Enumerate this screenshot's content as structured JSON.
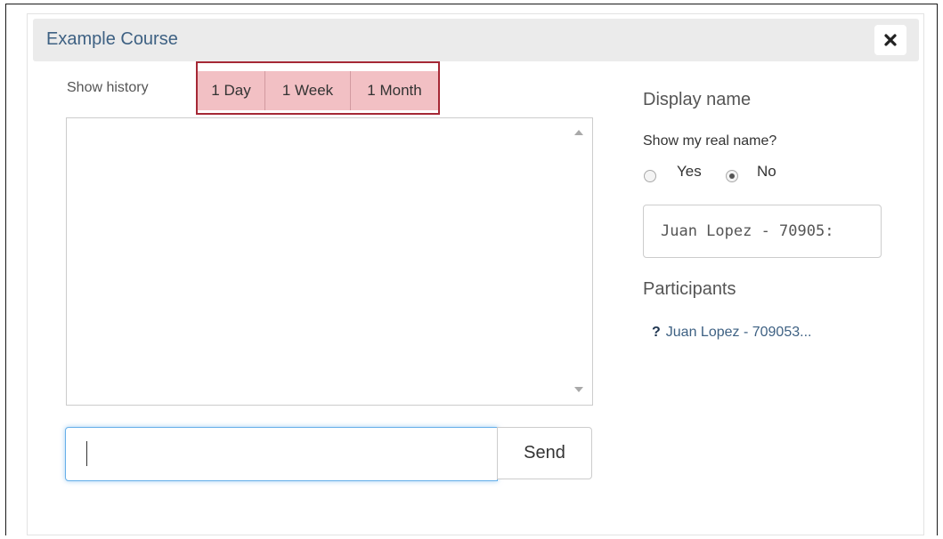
{
  "dialog": {
    "title": "Example Course",
    "close_icon": "close-icon"
  },
  "history": {
    "label": "Show history",
    "options": [
      "1 Day",
      "1 Week",
      "1 Month"
    ],
    "highlight_color": "#a52835"
  },
  "chat": {
    "input_value": "",
    "send_label": "Send"
  },
  "display_name": {
    "title": "Display name",
    "question": "Show my real name?",
    "options": [
      "Yes",
      "No"
    ],
    "selected": "No",
    "name_value": "Juan Lopez - 70905:"
  },
  "participants": {
    "title": "Participants",
    "items": [
      {
        "status_icon": "?",
        "name": "Juan Lopez - 709053..."
      }
    ]
  },
  "colors": {
    "accent": "#3e6183",
    "focus": "#66afe9",
    "highlight_fill": "#f2c0c4"
  }
}
